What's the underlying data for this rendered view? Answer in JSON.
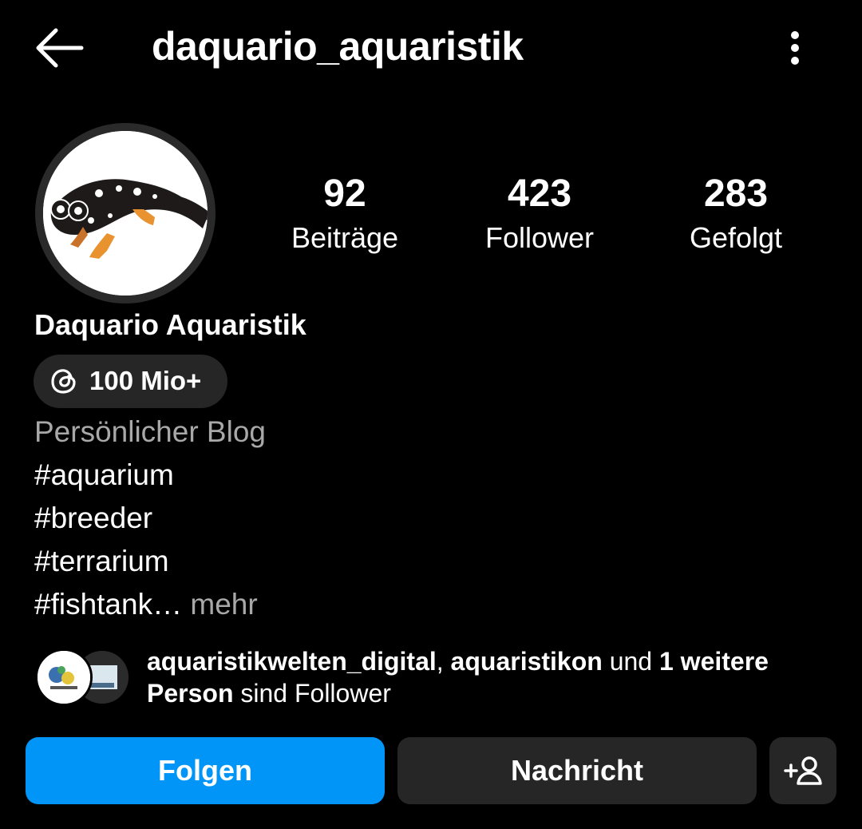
{
  "header": {
    "title": "daquario_aquaristik",
    "back_icon": "arrow-left-icon",
    "more_icon": "more-vertical-icon"
  },
  "stats": {
    "posts_count": "92",
    "posts_label": "Beiträge",
    "followers_count": "423",
    "followers_label": "Follower",
    "following_count": "283",
    "following_label": "Gefolgt"
  },
  "profile": {
    "name": "Daquario Aquaristik",
    "threads_badge": "100 Mio+",
    "category": "Persönlicher Blog",
    "bio_lines": [
      "#aquarium",
      "#breeder",
      "#terrarium",
      "#fishtank…"
    ],
    "more_label": " mehr"
  },
  "followed_by": {
    "user1": "aquaristikwelten_digital",
    "sep": ", ",
    "user2": "aquaristikon",
    "mid": " und ",
    "count_text": "1 weitere Person",
    "end": " sind Follower"
  },
  "actions": {
    "follow_label": "Folgen",
    "message_label": "Nachricht",
    "add_user_icon": "add-person-icon"
  },
  "colors": {
    "background": "#000000",
    "primary_button": "#0095f6",
    "secondary_button": "#262626",
    "muted_text": "#a8a8a8"
  }
}
